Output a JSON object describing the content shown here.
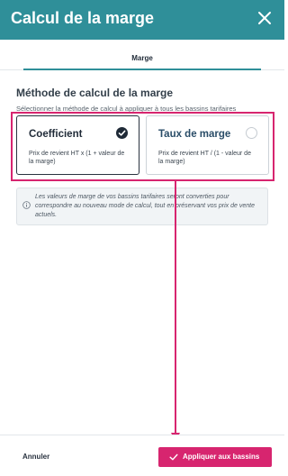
{
  "header": {
    "title": "Calcul de la marge",
    "close_icon": "close-icon"
  },
  "tabs": [
    {
      "label": "Marge",
      "active": true
    }
  ],
  "section": {
    "title": "Méthode de calcul de la marge",
    "subtitle": "Sélectionner la méthode de calcul à appliquer à tous les bassins tarifaires"
  },
  "options": [
    {
      "title": "Coefficient",
      "description": "Prix de revient HT x (1 + valeur de la marge)",
      "selected": true,
      "icon": "check-circle-icon"
    },
    {
      "title": "Taux de marge",
      "description": "Prix de revient HT / (1 - valeur de la marge)",
      "selected": false,
      "icon": "radio-empty-icon"
    }
  ],
  "info": {
    "icon": "info-icon",
    "text": "Les valeurs de marge de vos bassins tarifaires seront converties pour correspondre au nouveau mode de calcul, tout en préservant vos prix de vente actuels."
  },
  "footer": {
    "cancel_label": "Annuler",
    "apply_label": "Appliquer aux bassins",
    "apply_icon": "check-icon"
  },
  "colors": {
    "header_bg": "#2f8f99",
    "accent": "#d7256f",
    "selected_dark": "#1f2a37"
  }
}
